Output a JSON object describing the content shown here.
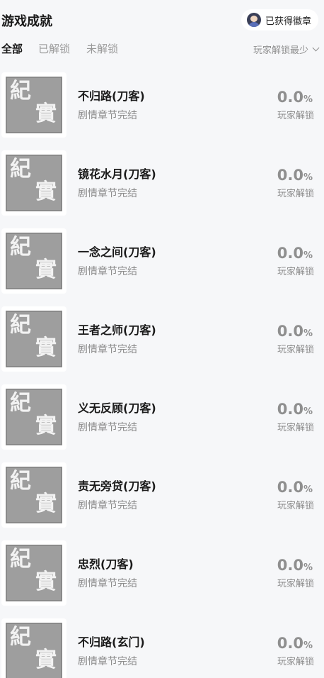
{
  "header": {
    "title": "游戏成就",
    "badge_button": "已获得徽章"
  },
  "tabs": [
    {
      "label": "全部",
      "active": true
    },
    {
      "label": "已解锁",
      "active": false
    },
    {
      "label": "未解锁",
      "active": false
    }
  ],
  "sort": {
    "label": "玩家解锁最少"
  },
  "seal": {
    "char1": "紀",
    "char2": "實"
  },
  "achievements": [
    {
      "name": "不归路(刀客)",
      "desc": "剧情章节完结",
      "rate": "0.0",
      "unit": "%",
      "rate_label": "玩家解锁"
    },
    {
      "name": "镜花水月(刀客)",
      "desc": "剧情章节完结",
      "rate": "0.0",
      "unit": "%",
      "rate_label": "玩家解锁"
    },
    {
      "name": "一念之间(刀客)",
      "desc": "剧情章节完结",
      "rate": "0.0",
      "unit": "%",
      "rate_label": "玩家解锁"
    },
    {
      "name": "王者之师(刀客)",
      "desc": "剧情章节完结",
      "rate": "0.0",
      "unit": "%",
      "rate_label": "玩家解锁"
    },
    {
      "name": "义无反顾(刀客)",
      "desc": "剧情章节完结",
      "rate": "0.0",
      "unit": "%",
      "rate_label": "玩家解锁"
    },
    {
      "name": "责无旁贷(刀客)",
      "desc": "剧情章节完结",
      "rate": "0.0",
      "unit": "%",
      "rate_label": "玩家解锁"
    },
    {
      "name": "忠烈(刀客)",
      "desc": "剧情章节完结",
      "rate": "0.0",
      "unit": "%",
      "rate_label": "玩家解锁"
    },
    {
      "name": "不归路(玄门)",
      "desc": "剧情章节完结",
      "rate": "0.0",
      "unit": "%",
      "rate_label": "玩家解锁"
    }
  ]
}
